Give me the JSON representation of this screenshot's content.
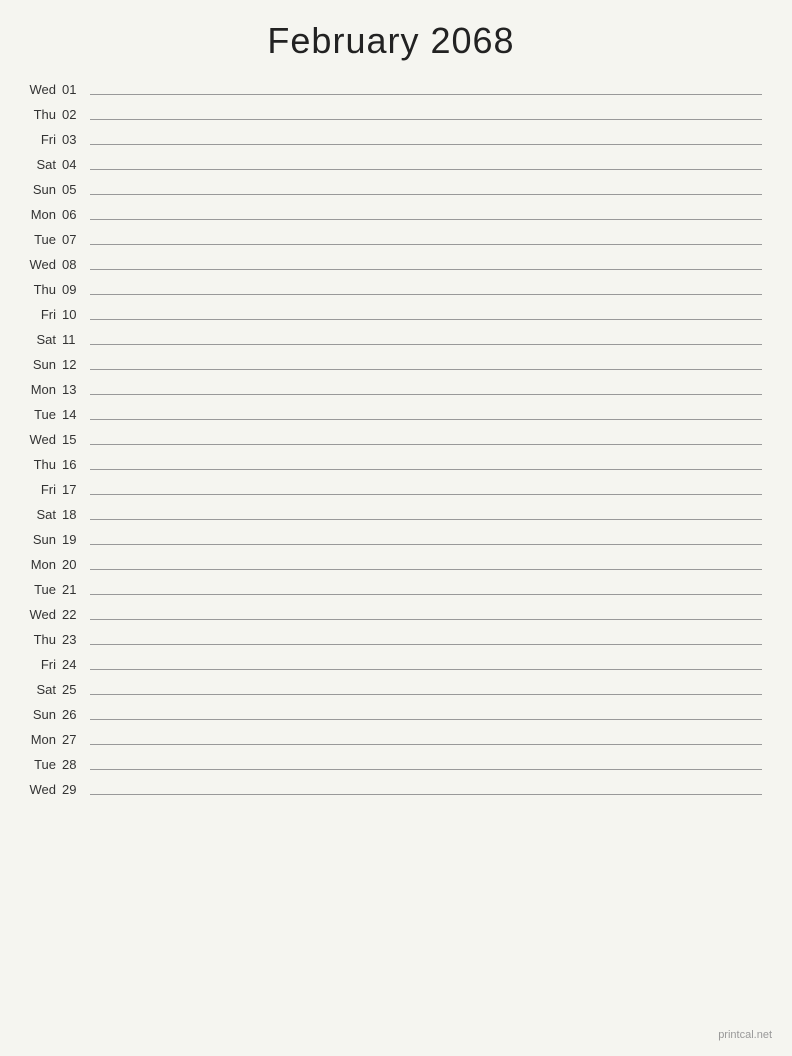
{
  "header": {
    "title": "February 2068"
  },
  "days": [
    {
      "name": "Wed",
      "number": "01"
    },
    {
      "name": "Thu",
      "number": "02"
    },
    {
      "name": "Fri",
      "number": "03"
    },
    {
      "name": "Sat",
      "number": "04"
    },
    {
      "name": "Sun",
      "number": "05"
    },
    {
      "name": "Mon",
      "number": "06"
    },
    {
      "name": "Tue",
      "number": "07"
    },
    {
      "name": "Wed",
      "number": "08"
    },
    {
      "name": "Thu",
      "number": "09"
    },
    {
      "name": "Fri",
      "number": "10"
    },
    {
      "name": "Sat",
      "number": "11"
    },
    {
      "name": "Sun",
      "number": "12"
    },
    {
      "name": "Mon",
      "number": "13"
    },
    {
      "name": "Tue",
      "number": "14"
    },
    {
      "name": "Wed",
      "number": "15"
    },
    {
      "name": "Thu",
      "number": "16"
    },
    {
      "name": "Fri",
      "number": "17"
    },
    {
      "name": "Sat",
      "number": "18"
    },
    {
      "name": "Sun",
      "number": "19"
    },
    {
      "name": "Mon",
      "number": "20"
    },
    {
      "name": "Tue",
      "number": "21"
    },
    {
      "name": "Wed",
      "number": "22"
    },
    {
      "name": "Thu",
      "number": "23"
    },
    {
      "name": "Fri",
      "number": "24"
    },
    {
      "name": "Sat",
      "number": "25"
    },
    {
      "name": "Sun",
      "number": "26"
    },
    {
      "name": "Mon",
      "number": "27"
    },
    {
      "name": "Tue",
      "number": "28"
    },
    {
      "name": "Wed",
      "number": "29"
    }
  ],
  "watermark": "printcal.net"
}
